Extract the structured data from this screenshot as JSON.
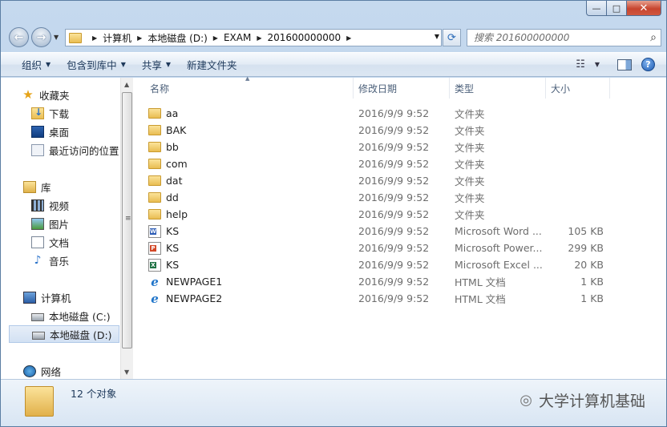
{
  "window": {
    "caption_min": "—",
    "caption_max": "□",
    "caption_close": "✕"
  },
  "address": {
    "crumbs": [
      "计算机",
      "本地磁盘 (D:)",
      "EXAM",
      "201600000000"
    ],
    "search_placeholder": "搜索 201600000000"
  },
  "toolbar": {
    "organize": "组织",
    "include_in_library": "包含到库中",
    "share": "共享",
    "new_folder": "新建文件夹"
  },
  "sidebar": {
    "favorites": {
      "label": "收藏夹",
      "items": [
        "下载",
        "桌面",
        "最近访问的位置"
      ]
    },
    "libraries": {
      "label": "库",
      "items": [
        "视频",
        "图片",
        "文档",
        "音乐"
      ]
    },
    "computer": {
      "label": "计算机",
      "items": [
        "本地磁盘 (C:)",
        "本地磁盘 (D:)"
      ]
    },
    "network": {
      "label": "网络"
    }
  },
  "columns": {
    "name": "名称",
    "date": "修改日期",
    "type": "类型",
    "size": "大小"
  },
  "files": [
    {
      "name": "aa",
      "date": "2016/9/9 9:52",
      "type": "文件夹",
      "size": "",
      "icon": "folder-icon"
    },
    {
      "name": "BAK",
      "date": "2016/9/9 9:52",
      "type": "文件夹",
      "size": "",
      "icon": "folder-icon"
    },
    {
      "name": "bb",
      "date": "2016/9/9 9:52",
      "type": "文件夹",
      "size": "",
      "icon": "folder-icon"
    },
    {
      "name": "com",
      "date": "2016/9/9 9:52",
      "type": "文件夹",
      "size": "",
      "icon": "folder-icon"
    },
    {
      "name": "dat",
      "date": "2016/9/9 9:52",
      "type": "文件夹",
      "size": "",
      "icon": "folder-icon"
    },
    {
      "name": "dd",
      "date": "2016/9/9 9:52",
      "type": "文件夹",
      "size": "",
      "icon": "folder-icon"
    },
    {
      "name": "help",
      "date": "2016/9/9 9:52",
      "type": "文件夹",
      "size": "",
      "icon": "folder-icon"
    },
    {
      "name": "KS",
      "date": "2016/9/9 9:52",
      "type": "Microsoft Word ...",
      "size": "105 KB",
      "icon": "word-doc-icon"
    },
    {
      "name": "KS",
      "date": "2016/9/9 9:52",
      "type": "Microsoft Power...",
      "size": "299 KB",
      "icon": "powerpoint-doc-icon"
    },
    {
      "name": "KS",
      "date": "2016/9/9 9:52",
      "type": "Microsoft Excel ...",
      "size": "20 KB",
      "icon": "excel-doc-icon"
    },
    {
      "name": "NEWPAGE1",
      "date": "2016/9/9 9:52",
      "type": "HTML 文档",
      "size": "1 KB",
      "icon": "html-doc-icon"
    },
    {
      "name": "NEWPAGE2",
      "date": "2016/9/9 9:52",
      "type": "HTML 文档",
      "size": "1 KB",
      "icon": "html-doc-icon"
    }
  ],
  "status": {
    "count_text": "12 个对象"
  },
  "watermark": {
    "text": "大学计算机基础"
  }
}
